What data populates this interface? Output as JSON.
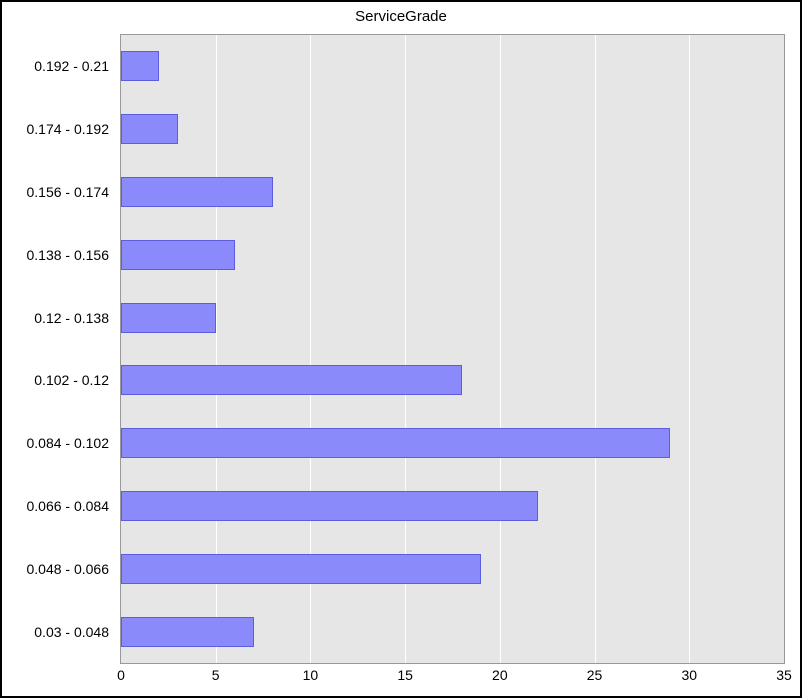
{
  "chart_data": {
    "type": "bar",
    "orientation": "horizontal",
    "title": "ServiceGrade",
    "xlabel": "",
    "ylabel": "",
    "xlim": [
      0,
      35
    ],
    "x_ticks": [
      0,
      5,
      10,
      15,
      20,
      25,
      30,
      35
    ],
    "categories": [
      "0.192 - 0.21",
      "0.174 - 0.192",
      "0.156 - 0.174",
      "0.138 - 0.156",
      "0.12 - 0.138",
      "0.102 - 0.12",
      "0.084 - 0.102",
      "0.066 - 0.084",
      "0.048 - 0.066",
      "0.03 - 0.048"
    ],
    "values": [
      2,
      3,
      8,
      6,
      5,
      18,
      29,
      22,
      19,
      7
    ],
    "colors": {
      "bar_fill": "#8b8afb",
      "bar_border": "#5d5de0",
      "plot_bg": "#e6e6e6",
      "grid": "#ffffff"
    }
  }
}
